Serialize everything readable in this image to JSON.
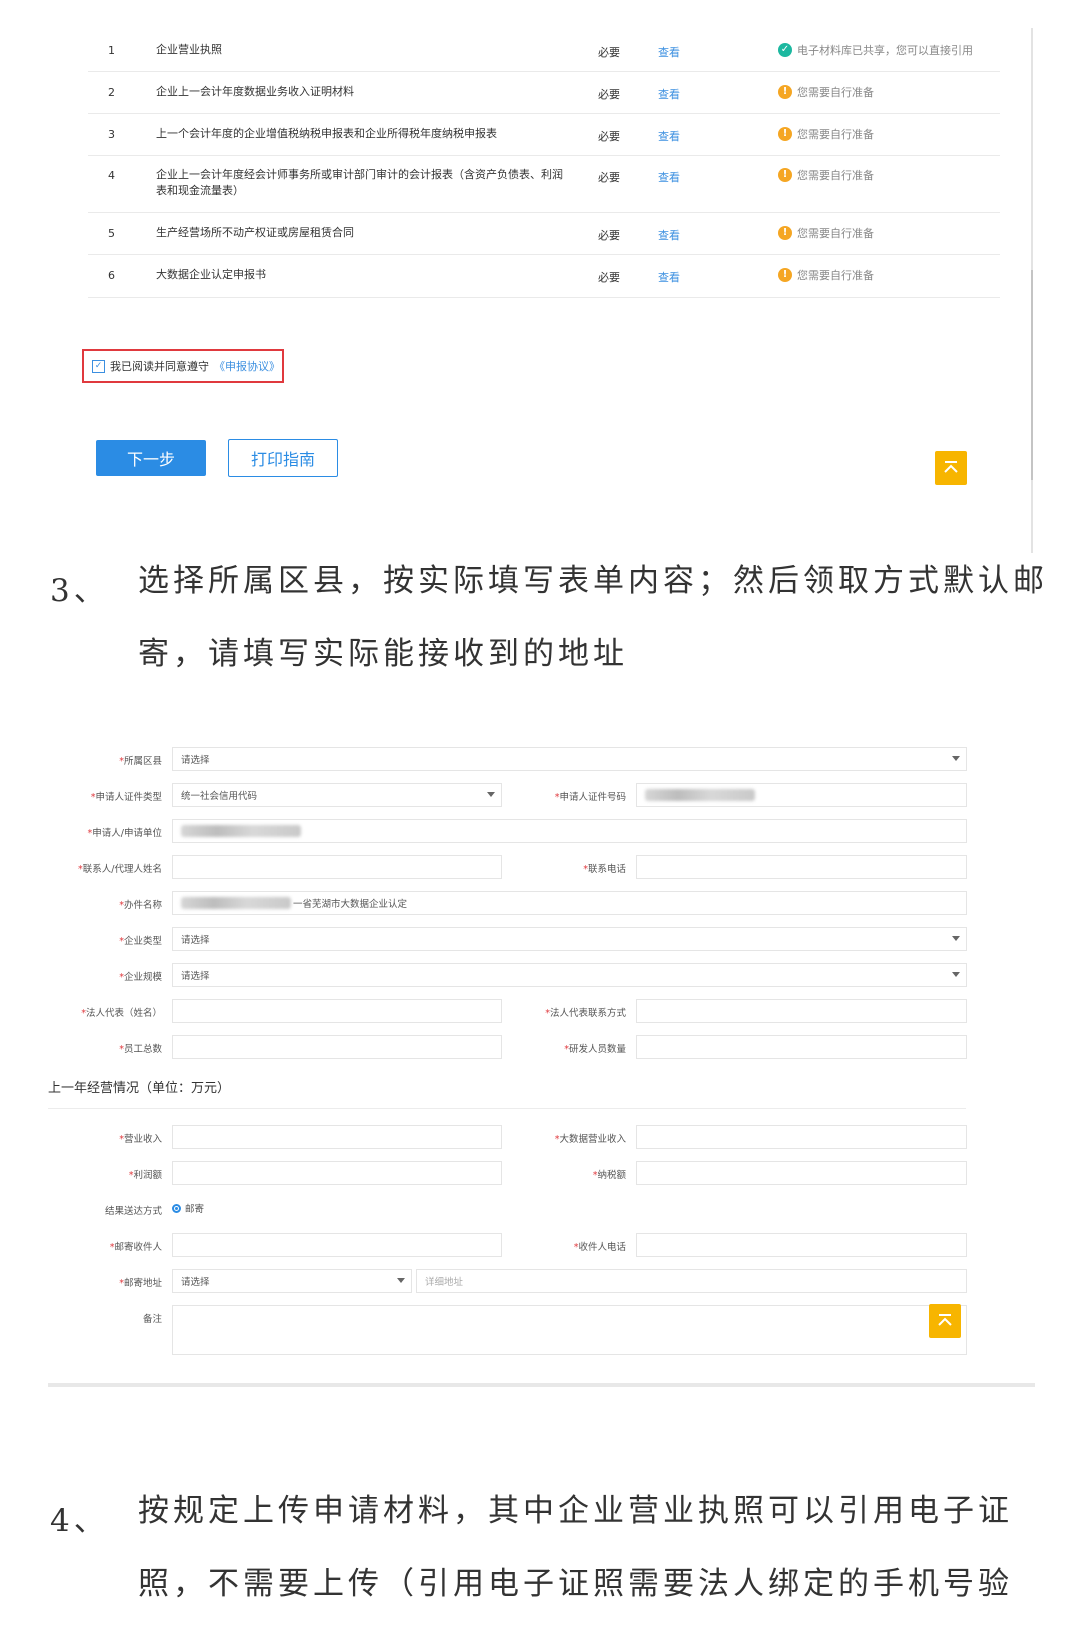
{
  "materials": [
    {
      "no": "1",
      "name": "企业营业执照",
      "req": "必要",
      "view": "查看",
      "status": "电子材料库已共享，您可以直接引用",
      "type": "ok"
    },
    {
      "no": "2",
      "name": "企业上一会计年度数据业务收入证明材料",
      "req": "必要",
      "view": "查看",
      "status": "您需要自行准备",
      "type": "warn"
    },
    {
      "no": "3",
      "name": "上一个会计年度的企业增值税纳税申报表和企业所得税年度纳税申报表",
      "req": "必要",
      "view": "查看",
      "status": "您需要自行准备",
      "type": "warn"
    },
    {
      "no": "4",
      "name": "企业上一会计年度经会计师事务所或审计部门审计的会计报表（含资产负债表、利润表和现金流量表）",
      "req": "必要",
      "view": "查看",
      "status": "您需要自行准备",
      "type": "warn"
    },
    {
      "no": "5",
      "name": "生产经营场所不动产权证或房屋租赁合同",
      "req": "必要",
      "view": "查看",
      "status": "您需要自行准备",
      "type": "warn"
    },
    {
      "no": "6",
      "name": "大数据企业认定申报书",
      "req": "必要",
      "view": "查看",
      "status": "您需要自行准备",
      "type": "warn"
    }
  ],
  "agree": {
    "text": "我已阅读并同意遵守",
    "link": "《申报协议》"
  },
  "buttons": {
    "next": "下一步",
    "print": "打印指南"
  },
  "step3": {
    "num": "3、",
    "text": "选择所属区县，按实际填写表单内容；然后领取方式默认邮寄，请填写实际能接收到的地址"
  },
  "form": {
    "district": {
      "label": "所属区县",
      "value": "请选择"
    },
    "cert_type": {
      "label": "申请人证件类型",
      "value": "统一社会信用代码"
    },
    "cert_no": {
      "label": "申请人证件号码"
    },
    "applicant": {
      "label": "申请人/申请单位"
    },
    "contact_name": {
      "label": "联系人/代理人姓名"
    },
    "contact_phone": {
      "label": "联系电话"
    },
    "case_name": {
      "label": "办件名称",
      "value": "一省芜湖市大数据企业认定"
    },
    "company_type": {
      "label": "企业类型",
      "value": "请选择"
    },
    "company_scale": {
      "label": "企业规模",
      "value": "请选择"
    },
    "legal_rep": {
      "label": "法人代表（姓名）"
    },
    "legal_contact": {
      "label": "法人代表联系方式"
    },
    "staff_total": {
      "label": "员工总数"
    },
    "rd_staff": {
      "label": "研发人员数量"
    },
    "section": "上一年经营情况（单位：万元）",
    "revenue": {
      "label": "营业收入"
    },
    "bigdata_revenue": {
      "label": "大数据营业收入"
    },
    "profit": {
      "label": "利润额"
    },
    "tax": {
      "label": "纳税额"
    },
    "delivery": {
      "label": "结果送达方式",
      "option": "邮寄"
    },
    "recipient": {
      "label": "邮寄收件人"
    },
    "recipient_phone": {
      "label": "收件人电话"
    },
    "address": {
      "label": "邮寄地址",
      "value": "请选择",
      "detail_placeholder": "详细地址"
    },
    "remark": {
      "label": "备注"
    }
  },
  "step4": {
    "num": "4、",
    "text": "按规定上传申请材料，其中企业营业执照可以引用电子证照，不需要上传（引用电子证照需要法人绑定的手机号验"
  },
  "colors": {
    "primary": "#2b8ce4",
    "ok": "#1cb8a0",
    "warn": "#f5a623",
    "totop": "#f7b500",
    "required": "#e0393e"
  },
  "icons": {
    "ok": "check-circle-icon",
    "warn": "exclamation-circle-icon",
    "totop": "back-to-top-icon",
    "dropdown": "caret-down-icon"
  }
}
